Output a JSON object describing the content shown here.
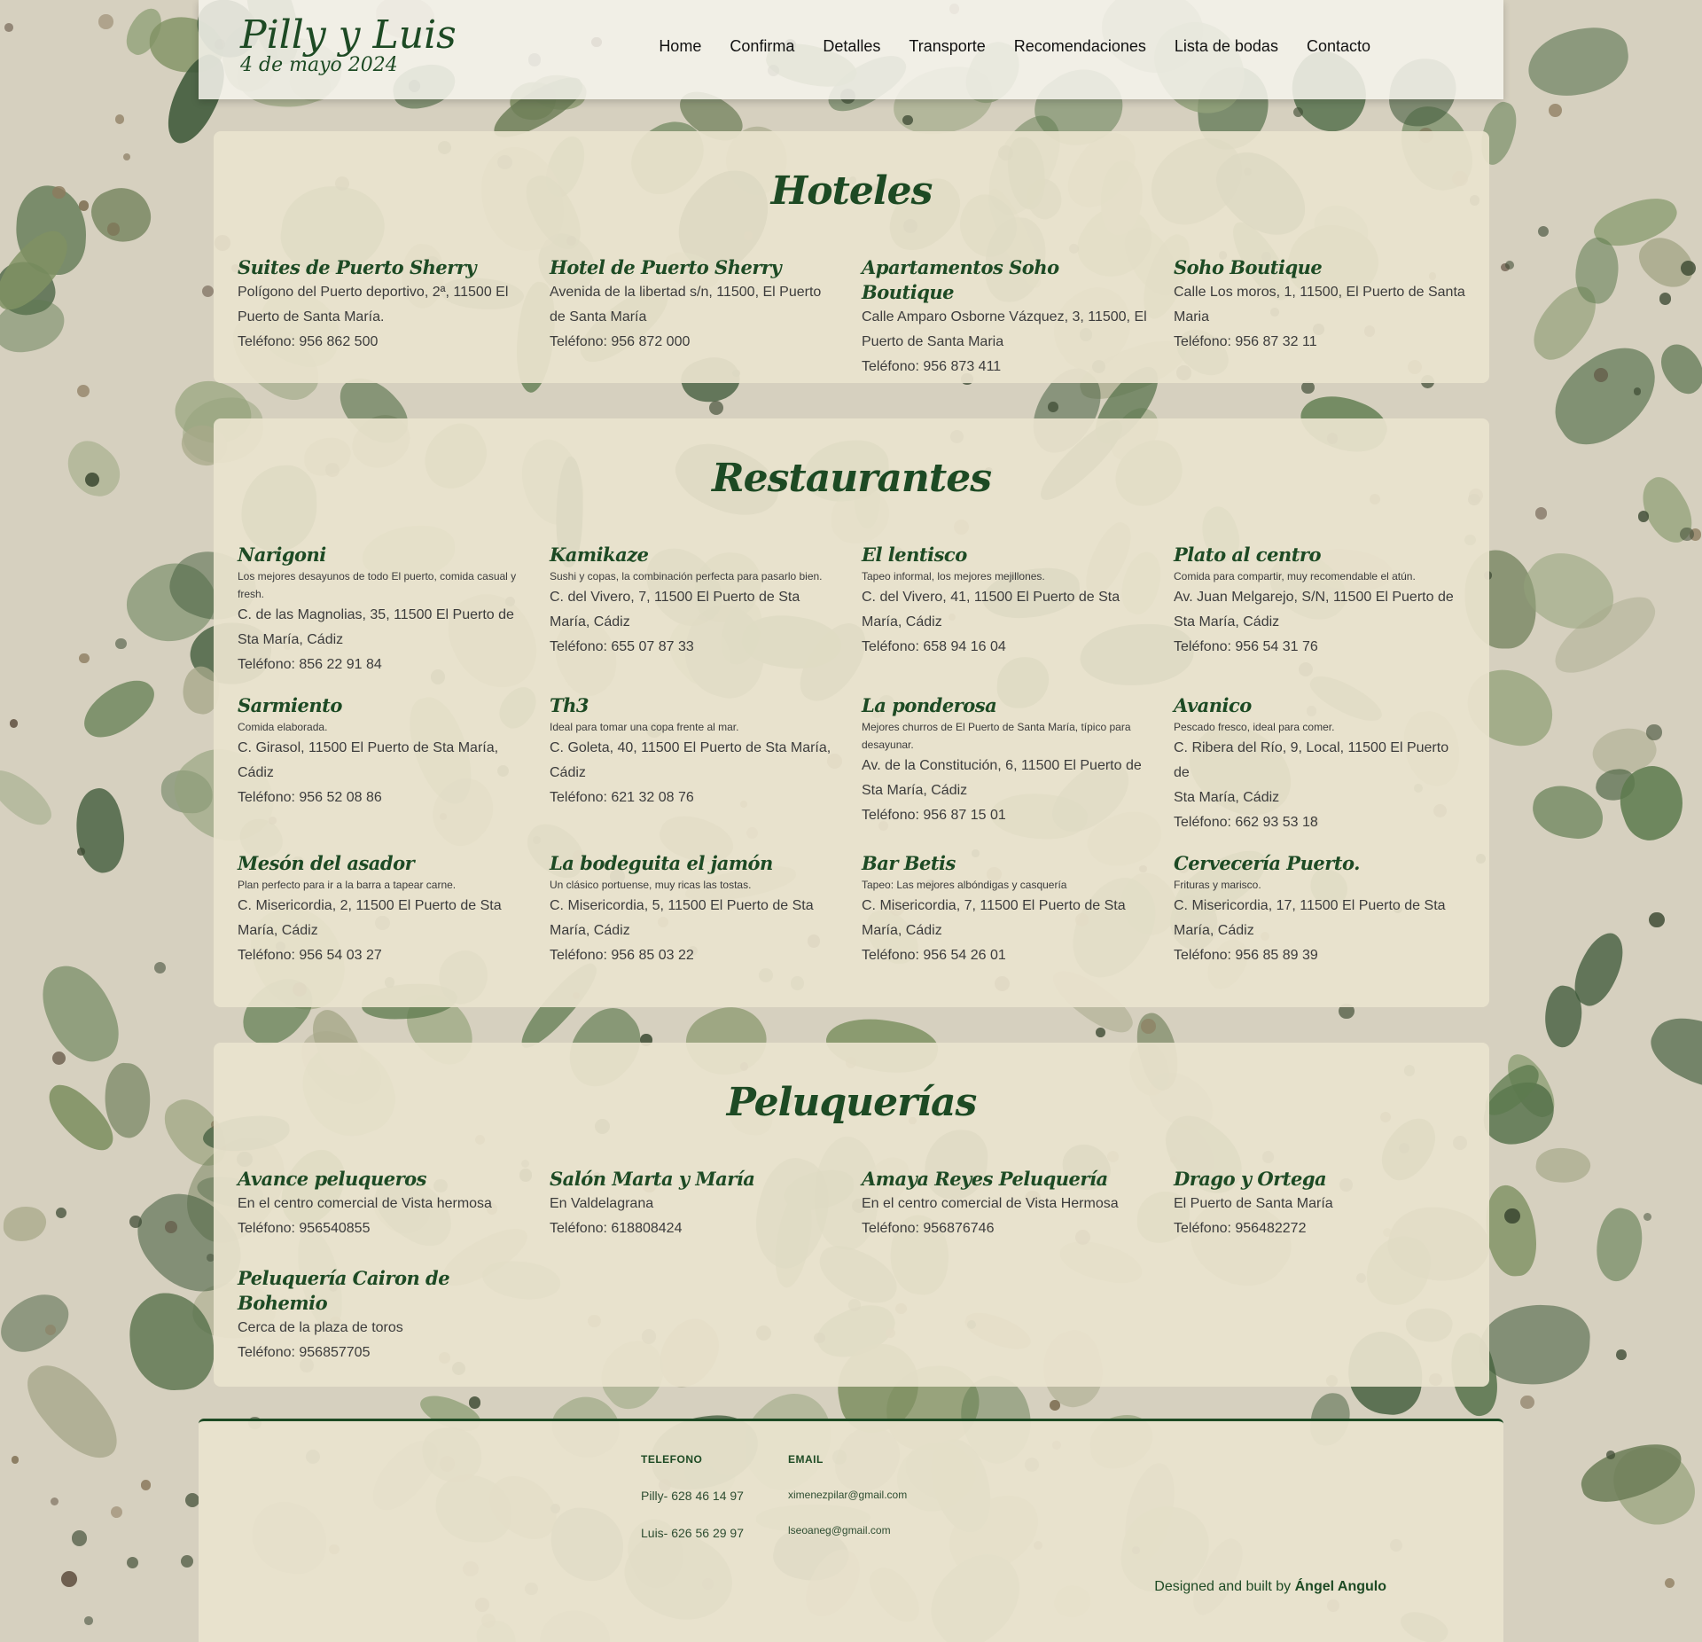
{
  "brand": {
    "name": "Pilly y Luis",
    "date": "4 de mayo 2024"
  },
  "nav": [
    "Home",
    "Confirma",
    "Detalles",
    "Transporte",
    "Recomendaciones",
    "Lista de bodas",
    "Contacto"
  ],
  "hoteles": {
    "title": "Hoteles",
    "items": [
      {
        "name": "Suites de Puerto Sherry",
        "lines": [
          "Polígono del Puerto deportivo, 2ª, 11500 El",
          "Puerto de Santa María.",
          "Teléfono: 956 862 500"
        ]
      },
      {
        "name": "Hotel de Puerto Sherry",
        "lines": [
          "Avenida de la libertad s/n, 11500, El Puerto",
          "de Santa María",
          "Teléfono: 956 872 000"
        ]
      },
      {
        "name": "Apartamentos Soho Boutique",
        "lines": [
          "Calle Amparo Osborne Vázquez, 3, 11500, El",
          "Puerto de Santa Maria",
          "Teléfono: 956 873 411"
        ]
      },
      {
        "name": "Soho Boutique",
        "lines": [
          "Calle Los moros, 1, 11500, El Puerto de Santa",
          "Maria",
          "Teléfono: 956 87 32 11"
        ]
      }
    ]
  },
  "restaurantes": {
    "title": "Restaurantes",
    "items": [
      {
        "name": "Narigoni",
        "desc": "Los mejores desayunos de todo El puerto, comida casual y fresh.",
        "lines": [
          "C. de las Magnolias, 35, 11500 El Puerto de",
          "Sta María, Cádiz",
          "Teléfono: 856 22 91 84"
        ]
      },
      {
        "name": "Kamikaze",
        "desc": "Sushi y copas, la combinación perfecta para pasarlo bien.",
        "lines": [
          "C. del Vivero, 7, 11500 El Puerto de Sta",
          "María, Cádiz",
          "Teléfono: 655 07 87 33"
        ]
      },
      {
        "name": "El lentisco",
        "desc": "Tapeo informal, los mejores mejillones.",
        "lines": [
          "C. del Vivero, 41, 11500 El Puerto de Sta",
          "María, Cádiz",
          "Teléfono: 658 94 16 04"
        ]
      },
      {
        "name": "Plato al centro",
        "desc": "Comida para compartir, muy recomendable el atún.",
        "lines": [
          "Av. Juan Melgarejo, S/N, 11500 El Puerto de",
          "Sta María, Cádiz",
          "Teléfono: 956 54 31 76"
        ]
      },
      {
        "name": "Sarmiento",
        "desc": "Comida elaborada.",
        "lines": [
          "C. Girasol, 11500 El Puerto de Sta María,",
          "Cádiz",
          "Teléfono: 956 52 08 86"
        ]
      },
      {
        "name": "Th3",
        "desc": "Ideal para tomar una copa frente al mar.",
        "lines": [
          "C. Goleta, 40, 11500 El Puerto de Sta María,",
          "Cádiz",
          "Teléfono: 621 32 08 76"
        ]
      },
      {
        "name": "La ponderosa",
        "desc": "Mejores churros de El Puerto de Santa María, típico para desayunar.",
        "lines": [
          "Av. de la Constitución, 6, 11500 El Puerto de",
          "Sta María, Cádiz",
          "Teléfono: 956 87 15 01"
        ]
      },
      {
        "name": "Avanico",
        "desc": "Pescado fresco, ideal para comer.",
        "lines": [
          "C. Ribera del Río, 9, Local, 11500 El Puerto de",
          "Sta María, Cádiz",
          "Teléfono: 662 93 53 18"
        ]
      },
      {
        "name": "Mesón del asador",
        "desc": "Plan perfecto para ir a la barra a tapear carne.",
        "lines": [
          "C. Misericordia, 2, 11500 El Puerto de Sta",
          "María, Cádiz",
          "Teléfono: 956 54 03 27"
        ]
      },
      {
        "name": "La bodeguita el jamón",
        "desc": "Un clásico portuense, muy ricas las tostas.",
        "lines": [
          "C. Misericordia, 5, 11500 El Puerto de Sta",
          "María, Cádiz",
          "Teléfono: 956 85 03 22"
        ]
      },
      {
        "name": "Bar Betis",
        "desc": "Tapeo: Las mejores albóndigas y casquería",
        "lines": [
          "C. Misericordia, 7, 11500 El Puerto de Sta",
          "María, Cádiz",
          "Teléfono: 956 54 26 01"
        ]
      },
      {
        "name": "Cervecería Puerto.",
        "desc": "Frituras y marisco.",
        "lines": [
          "C. Misericordia, 17, 11500 El Puerto de Sta",
          "María, Cádiz",
          "Teléfono: 956 85 89 39"
        ]
      }
    ]
  },
  "peluquerias": {
    "title": "Peluquerías",
    "items": [
      {
        "name": "Avance peluqueros",
        "lines": [
          "En el centro comercial de Vista hermosa",
          "Teléfono: 956540855"
        ]
      },
      {
        "name": "Salón Marta y María",
        "lines": [
          "En Valdelagrana",
          "Teléfono: 618808424"
        ]
      },
      {
        "name": "Amaya Reyes Peluquería",
        "lines": [
          "En el centro comercial de Vista Hermosa",
          "Teléfono: 956876746"
        ]
      },
      {
        "name": "Drago y Ortega",
        "lines": [
          "El Puerto de Santa María",
          "Teléfono: 956482272"
        ]
      },
      {
        "name": "Peluquería Cairon de Bohemio",
        "lines": [
          "Cerca de la plaza de toros",
          "Teléfono: 956857705"
        ]
      }
    ]
  },
  "footer": {
    "telefono_label": "TELEFONO",
    "phones": [
      "Pilly- 628 46 14 97",
      "Luis- 626 56 29 97"
    ],
    "email_label": "EMAIL",
    "emails": [
      "ximenezpilar@gmail.com",
      "lseoaneg@gmail.com"
    ],
    "credit_prefix": "Designed and built by",
    "credit_name": "Ángel Angulo"
  },
  "colors": {
    "accent": "#1d4a24",
    "card": "#e9e3ce",
    "background": "#d6d0bf"
  }
}
